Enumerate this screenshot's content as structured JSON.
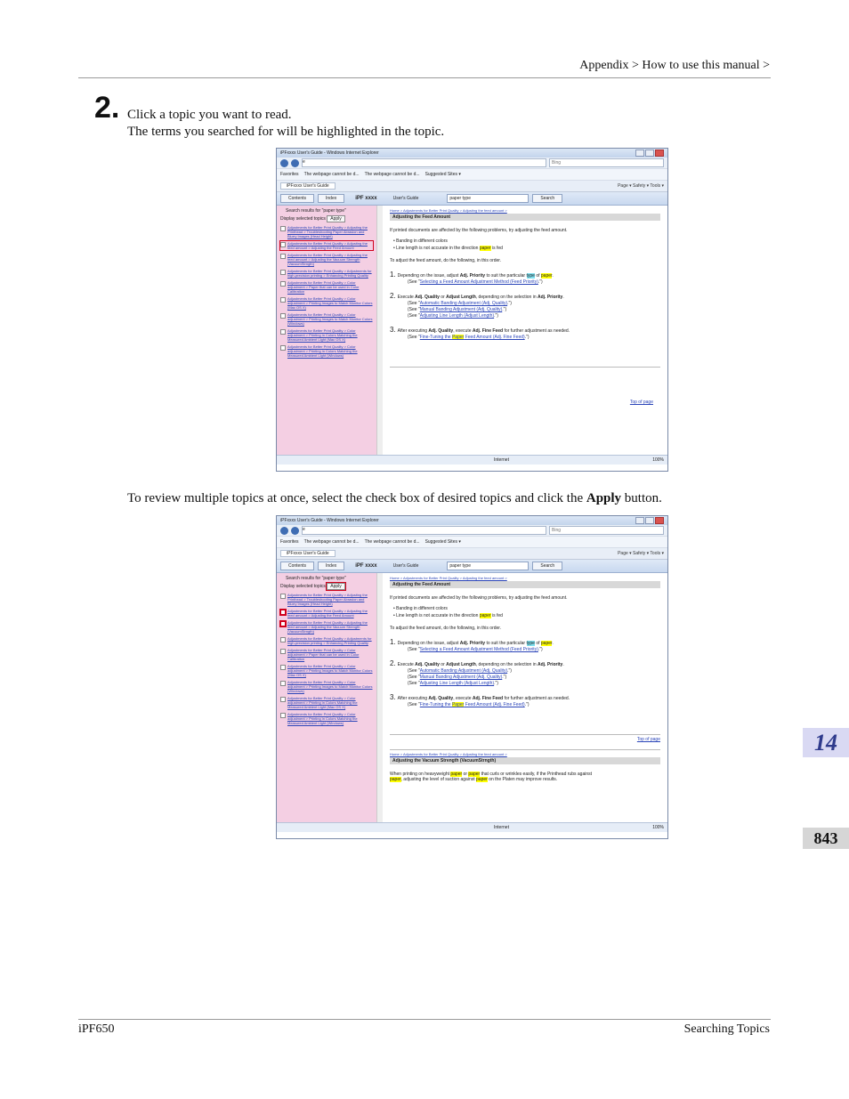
{
  "header": {
    "breadcrumb": "Appendix > How to use this manual >"
  },
  "step": {
    "number": "2.",
    "line1": "Click a topic you want to read.",
    "line2": "The terms you searched for will be highlighted in the topic."
  },
  "paragraph2": {
    "before": "To review multiple topics at once, select the check box of desired topics and click the ",
    "bold": "Apply",
    "after": " button."
  },
  "side_tabs": {
    "chapter": "14",
    "page": "843"
  },
  "footer": {
    "left": "iPF650",
    "right": "Searching Topics"
  },
  "browser": {
    "window_title": "iPFxxxx   User's Guide - Windows Internet Explorer",
    "address": "e",
    "search_placeholder": "Bing",
    "favorites": "Favorites",
    "fav1": "The webpage cannot be d...",
    "fav2": "The webpage cannot be d...",
    "fav3": "Suggested Sites ▾",
    "tab": "iPFxxxx  User's Guide",
    "tools": "Page ▾  Safety ▾  Tools ▾",
    "contents": "Contents",
    "index": "Index",
    "brand": "iPF xxxx",
    "users_guide": "User's Guide",
    "query": "paper type",
    "search_btn": "Search",
    "status_internet": "Internet",
    "status_zoom": "100%"
  },
  "results": {
    "heading": "Search results for \"paper type\"",
    "display_selected": "Display selected topics",
    "apply": "Apply",
    "items": [
      "Adjustments for Better Print Quality > Adjusting the Printhead > Troubleshooting Paper Abrasion and Blurry Images (Head Height)",
      "Adjustments for Better Print Quality > Adjusting the feed amount > Adjusting the Feed Amount",
      "Adjustments for Better Print Quality > Adjusting the feed amount > Adjusting the Vacuum Strength (VacuumStrngth)",
      "Adjustments for Better Print Quality > Adjustments for high-precision printing > Enhancing Printing Quality",
      "Adjustments for Better Print Quality > Color adjustment > Paper that can be used in Color Calibration",
      "Adjustments for Better Print Quality > Color adjustment > Printing Images to Match Monitor Colors (Mac OS X)",
      "Adjustments for Better Print Quality > Color adjustment > Printing Images to Match Monitor Colors (Windows)",
      "Adjustments for Better Print Quality > Color adjustment > Printing in Colors Matching the Measured Ambient Light (Mac OS X)",
      "Adjustments for Better Print Quality > Color adjustment > Printing in Colors Matching the Measured Ambient Light (Windows)"
    ]
  },
  "article": {
    "breadcrumb": "Home > Adjustments for Better Print Quality > Adjusting the feed amount >",
    "title": "Adjusting the Feed Amount",
    "intro": "If printed documents are affected by the following problems, try adjusting the feed amount.",
    "bullet1": "• Banding in different colors",
    "bullet2a": "• Line length is not accurate in the direction ",
    "bullet2hl": "paper",
    "bullet2b": " is fed",
    "todo": "To adjust the feed amount, do the following, in this order.",
    "s1": {
      "num": "1.",
      "pre": "Depending on the issue, adjust ",
      "b1": "Adj. Priority",
      "mid": " to suit the particular ",
      "hl1": "type",
      "of": " of ",
      "hl2": "paper",
      "end": ".",
      "see": "(See \"",
      "link": "Selecting a Feed Amount Adjustment Method (Feed Priority)",
      "close": ".\")"
    },
    "s2": {
      "num": "2.",
      "pre": "Execute ",
      "b1": "Adj. Quality",
      "or": " or ",
      "b2": "Adjust Length",
      "mid": ", depending on the selection in ",
      "b3": "Adj. Priority",
      "end": ".",
      "see1": "Automatic Banding Adjustment (Adj. Quality)",
      "see2": "Manual Banding Adjustment (Adj. Quality)",
      "see3": "Adjusting Line Length (Adjust Length)"
    },
    "s3": {
      "num": "3.",
      "pre": "After executing ",
      "b1": "Adj. Quality",
      "mid": ", execute ",
      "b2": "Adj. Fine Feed",
      "end": " for further adjustment as needed.",
      "link_a": "Fine-Tuning the ",
      "link_hl": "Paper",
      "link_b": " Feed Amount (Adj. Fine Feed)"
    },
    "top_of_page": "Top of page",
    "second": {
      "breadcrumb": "Home > Adjustments for Better Print Quality > Adjusting the feed amount >",
      "title": "Adjusting the Vacuum Strength (VacuumStrngth)",
      "p1a": "When printing on heavyweight ",
      "p1hl1": "paper",
      "p1b": " or ",
      "p1hl2": "paper",
      "p1c": " that curls or wrinkles easily, if the Printhead rubs against",
      "p2hl": "paper",
      "p2a": ", adjusting the level of suction against ",
      "p2hl2": "paper",
      "p2b": " on the Platen may improve results."
    }
  }
}
